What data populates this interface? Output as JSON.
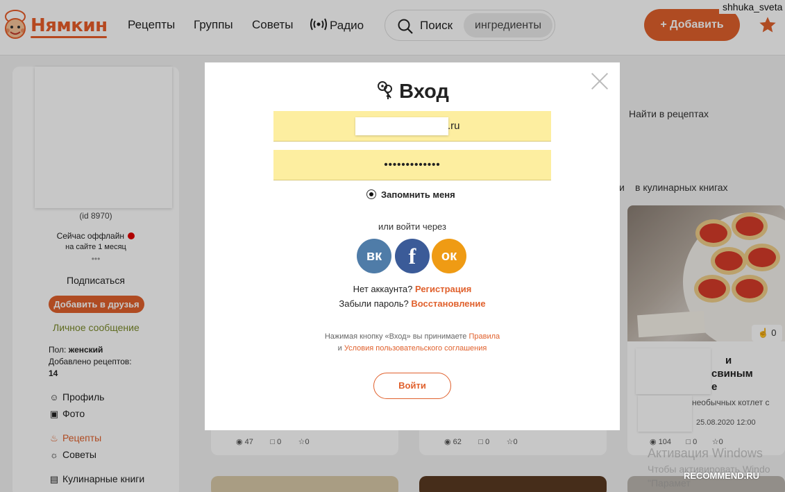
{
  "header": {
    "logo_text": "Нямкин",
    "nav": [
      "Рецепты",
      "Группы",
      "Советы",
      "Радио"
    ],
    "search_label": "Поиск",
    "search_tag": "ингредиенты",
    "add_button": "+ Добавить",
    "username": "shhuka_sveta"
  },
  "sidebar": {
    "user_id": "(id 8970)",
    "status": "Сейчас оффлайн",
    "on_site": "на сайте 1 месяц",
    "more": "•••",
    "subscribe": "Подписаться",
    "add_friend": "Добавить в друзья",
    "message": "Личное сообщение",
    "gender_label": "Пол:",
    "gender_value": "женский",
    "recipes_label": "Добавлено рецептов:",
    "recipes_count": "14",
    "links": [
      "Профиль",
      "Фото",
      "Рецепты",
      "Советы",
      "Кулинарные книги"
    ]
  },
  "background": {
    "find_in_recipes": "Найти в рецептах",
    "in_books": "в кулинарных книгах",
    "in_books_prefix": "и",
    "card_like": "0",
    "card_title_lines": [
      "и",
      "свиным",
      "е"
    ],
    "card_desc": "необычных котлет с",
    "card_date": "25.08.2020 12:00",
    "stats": [
      {
        "views": "47",
        "comments": "0",
        "favs": "0"
      },
      {
        "views": "62",
        "comments": "0",
        "favs": "0"
      },
      {
        "views": "104",
        "comments": "0",
        "favs": "0"
      }
    ],
    "watermark_line1": "Активация Windows",
    "watermark_line2": "Чтобы активировать Windo",
    "watermark_line3": "\"Парамет",
    "recommend": "RECOMMEND.RU"
  },
  "modal": {
    "title": "Вход",
    "email_suffix": ".ru",
    "password_mask": "•••••••••••••",
    "remember": "Запомнить меня",
    "or_login": "или войти через",
    "social": {
      "vk": "вк",
      "fb": "f",
      "ok": "ок"
    },
    "no_account": "Нет аккаунта?",
    "register": "Регистрация",
    "forgot": "Забыли пароль?",
    "restore": "Восстановление",
    "terms_prefix": "Нажимая кнопку «Вход» вы принимаете",
    "terms_rules": "Правила",
    "terms_and": "и",
    "terms_agreement": "Условия пользовательского соглашения",
    "login_button": "Войти"
  },
  "colors": {
    "accent": "#e0602c",
    "field_bg": "#fdeea0",
    "vk": "#4f7ca8",
    "fb": "#3b5b98",
    "ok": "#ef9b14"
  }
}
